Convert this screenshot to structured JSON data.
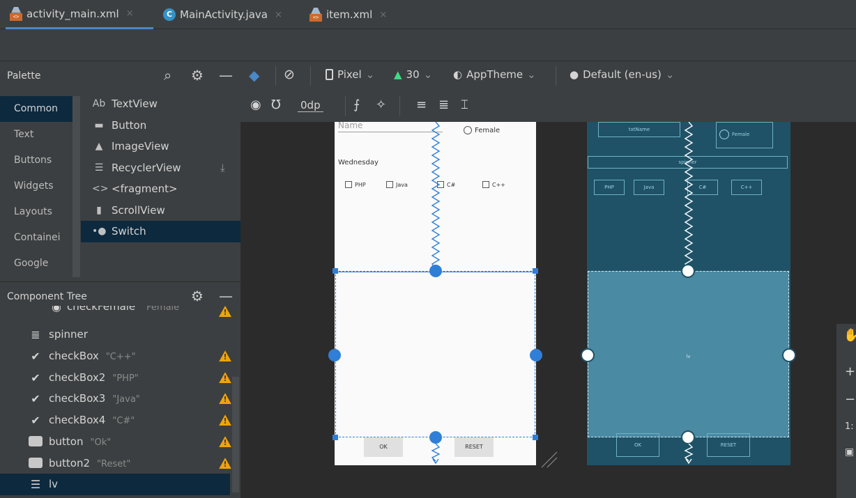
{
  "tabs": [
    {
      "label": "activity_main.xml",
      "close": "×",
      "icon": "xml-file-icon"
    },
    {
      "label": "MainActivity.java",
      "close": "×",
      "icon": "java-class-icon"
    },
    {
      "label": "item.xml",
      "close": "×",
      "icon": "xml-file-icon"
    }
  ],
  "palette": {
    "title": "Palette",
    "categories": [
      "Common",
      "Text",
      "Buttons",
      "Widgets",
      "Layouts",
      "Containei",
      "Google"
    ],
    "widgets": [
      {
        "icon": "Ab",
        "label": "TextView"
      },
      {
        "icon": "▬",
        "label": "Button"
      },
      {
        "icon": "▲",
        "label": "ImageView"
      },
      {
        "icon": "☰",
        "label": "RecyclerView"
      },
      {
        "icon": "<>",
        "label": "<fragment>"
      },
      {
        "icon": "▮",
        "label": "ScrollView"
      },
      {
        "icon": "•●",
        "label": "Switch"
      }
    ]
  },
  "component_tree": {
    "title": "Component Tree",
    "rows": [
      {
        "name": "checkFemale",
        "value": "\"Female\"",
        "icon": "radio-icon",
        "warn": true
      },
      {
        "name": "spinner",
        "value": "",
        "icon": "spinner-icon",
        "warn": false
      },
      {
        "name": "checkBox",
        "value": "\"C++\"",
        "icon": "check-icon",
        "warn": true
      },
      {
        "name": "checkBox2",
        "value": "\"PHP\"",
        "icon": "check-icon",
        "warn": true
      },
      {
        "name": "checkBox3",
        "value": "\"Java\"",
        "icon": "check-icon",
        "warn": true
      },
      {
        "name": "checkBox4",
        "value": "\"C#\"",
        "icon": "check-icon",
        "warn": true
      },
      {
        "name": "button",
        "value": "\"Ok\"",
        "icon": "button-icon",
        "warn": true
      },
      {
        "name": "button2",
        "value": "\"Reset\"",
        "icon": "button-icon",
        "warn": true
      },
      {
        "name": "lv",
        "value": "",
        "icon": "list-icon",
        "warn": false
      }
    ]
  },
  "toolbar": {
    "device": "Pixel",
    "api": "30",
    "theme": "AppTheme",
    "locale": "Default (en-us)",
    "margin": "0dp"
  },
  "design_preview": {
    "name_hint": "Name",
    "female_label": "Female",
    "day_label": "Wednesday",
    "checkboxes": [
      "PHP",
      "Java",
      "C#",
      "C++"
    ],
    "ok_label": "OK",
    "reset_label": "RESET"
  },
  "blueprint_preview": {
    "txtname": "txtName",
    "female": "Female",
    "spinner": "spinner",
    "checkboxes": [
      "PHP",
      "Java",
      "C#",
      "C++"
    ],
    "lv": "lv",
    "ok": "OK",
    "reset": "RESET"
  },
  "colors": {
    "accent": "#4a88c7",
    "selection": "#0d293e",
    "warning": "#f0a30a",
    "blueprint": "#1f5266",
    "constraint": "#2f7fd8"
  }
}
